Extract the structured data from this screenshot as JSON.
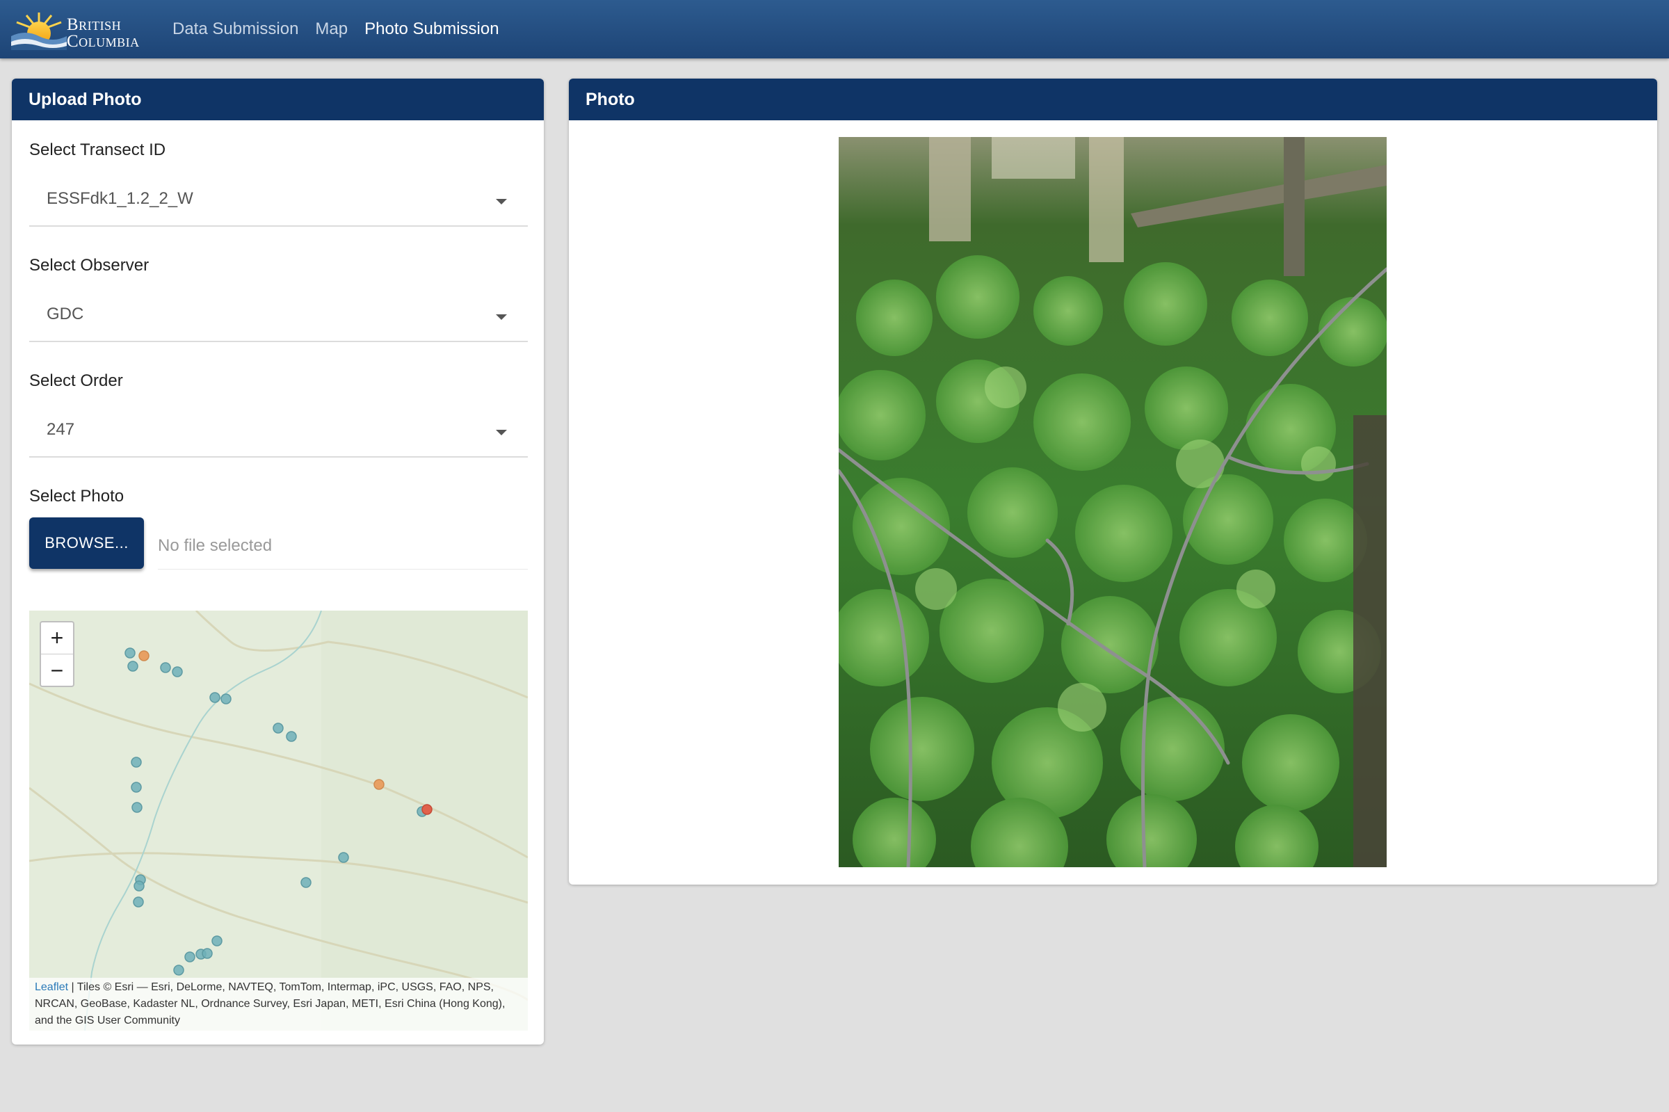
{
  "header": {
    "logo_line1": "British",
    "logo_line2": "Columbia",
    "nav": [
      {
        "label": "Data Submission",
        "active": false
      },
      {
        "label": "Map",
        "active": false
      },
      {
        "label": "Photo Submission",
        "active": true
      }
    ]
  },
  "upload": {
    "title": "Upload Photo",
    "transect_label": "Select Transect ID",
    "transect_value": "ESSFdk1_1.2_2_W",
    "observer_label": "Select Observer",
    "observer_value": "GDC",
    "order_label": "Select Order",
    "order_value": "247",
    "photo_label": "Select Photo",
    "browse_label": "BROWSE...",
    "file_placeholder": "No file selected"
  },
  "map": {
    "zoom_in": "+",
    "zoom_out": "−",
    "attribution_link": "Leaflet",
    "attribution_text": " | Tiles © Esri — Esri, DeLorme, NAVTEQ, TomTom, Intermap, iPC, USGS, FAO, NPS, NRCAN, GeoBase, Kadaster NL, Ordnance Survey, Esri Japan, METI, Esri China (Hong Kong), and the GIS User Community",
    "marker_colors": {
      "default": "#6fb0b8",
      "selected": "#e8a063",
      "current": "#e0614b"
    }
  },
  "photo_panel": {
    "title": "Photo"
  },
  "colors": {
    "nav_bg": "#1d4476",
    "card_header": "#0f3466",
    "page_bg": "#e0e0e0"
  }
}
